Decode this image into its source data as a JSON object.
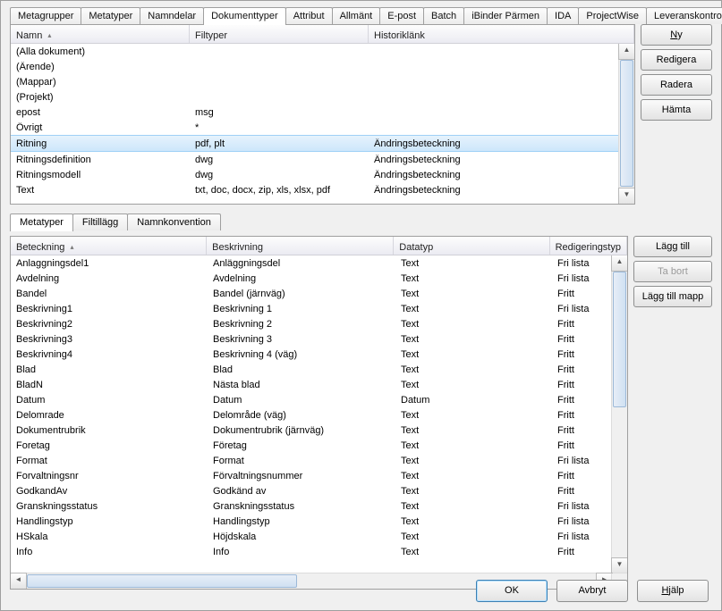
{
  "main_tabs": {
    "items": [
      "Metagrupper",
      "Metatyper",
      "Namndelar",
      "Dokumenttyper",
      "Attribut",
      "Allmänt",
      "E-post",
      "Batch",
      "iBinder Pärmen",
      "IDA",
      "ProjectWise",
      "Leveranskontroll"
    ],
    "active_index": 3
  },
  "top_grid": {
    "columns": [
      "Namn",
      "Filtyper",
      "Historiklänk"
    ],
    "sort_col": 0,
    "rows": [
      {
        "n": "(Alla dokument)",
        "f": "",
        "h": ""
      },
      {
        "n": "(Ärende)",
        "f": "",
        "h": ""
      },
      {
        "n": "(Mappar)",
        "f": "",
        "h": ""
      },
      {
        "n": "(Projekt)",
        "f": "",
        "h": ""
      },
      {
        "n": "epost",
        "f": "msg",
        "h": ""
      },
      {
        "n": "Övrigt",
        "f": "*",
        "h": ""
      },
      {
        "n": "Ritning",
        "f": "pdf, plt",
        "h": "Ändringsbeteckning",
        "sel": true
      },
      {
        "n": "Ritningsdefinition",
        "f": "dwg",
        "h": "Ändringsbeteckning"
      },
      {
        "n": "Ritningsmodell",
        "f": "dwg",
        "h": "Ändringsbeteckning"
      },
      {
        "n": "Text",
        "f": "txt, doc, docx, zip, xls, xlsx, pdf",
        "h": "Ändringsbeteckning"
      }
    ]
  },
  "top_buttons": {
    "ny": "Ny",
    "redigera": "Redigera",
    "radera": "Radera",
    "hamta": "Hämta"
  },
  "sub_tabs": {
    "items": [
      "Metatyper",
      "Filtillägg",
      "Namnkonvention"
    ],
    "active_index": 0
  },
  "bottom_grid": {
    "columns": [
      "Beteckning",
      "Beskrivning",
      "Datatyp",
      "Redigeringstyp"
    ],
    "sort_col": 0,
    "rows": [
      {
        "b": "Anlaggningsdel1",
        "d": "Anläggningsdel",
        "t": "Text",
        "r": "Fri lista"
      },
      {
        "b": "Avdelning",
        "d": "Avdelning",
        "t": "Text",
        "r": "Fri lista"
      },
      {
        "b": "Bandel",
        "d": "Bandel (järnväg)",
        "t": "Text",
        "r": "Fritt"
      },
      {
        "b": "Beskrivning1",
        "d": "Beskrivning 1",
        "t": "Text",
        "r": "Fri lista"
      },
      {
        "b": "Beskrivning2",
        "d": "Beskrivning 2",
        "t": "Text",
        "r": "Fritt"
      },
      {
        "b": "Beskrivning3",
        "d": "Beskrivning 3",
        "t": "Text",
        "r": "Fritt"
      },
      {
        "b": "Beskrivning4",
        "d": "Beskrivning 4 (väg)",
        "t": "Text",
        "r": "Fritt"
      },
      {
        "b": "Blad",
        "d": "Blad",
        "t": "Text",
        "r": "Fritt"
      },
      {
        "b": "BladN",
        "d": "Nästa blad",
        "t": "Text",
        "r": "Fritt"
      },
      {
        "b": "Datum",
        "d": "Datum",
        "t": "Datum",
        "r": "Fritt"
      },
      {
        "b": "Delomrade",
        "d": "Delområde (väg)",
        "t": "Text",
        "r": "Fritt"
      },
      {
        "b": "Dokumentrubrik",
        "d": "Dokumentrubrik (järnväg)",
        "t": "Text",
        "r": "Fritt"
      },
      {
        "b": "Foretag",
        "d": "Företag",
        "t": "Text",
        "r": "Fritt"
      },
      {
        "b": "Format",
        "d": "Format",
        "t": "Text",
        "r": "Fri lista"
      },
      {
        "b": "Forvaltningsnr",
        "d": "Förvaltningsnummer",
        "t": "Text",
        "r": "Fritt"
      },
      {
        "b": "GodkandAv",
        "d": "Godkänd av",
        "t": "Text",
        "r": "Fritt"
      },
      {
        "b": "Granskningsstatus",
        "d": "Granskningsstatus",
        "t": "Text",
        "r": "Fri lista"
      },
      {
        "b": "Handlingstyp",
        "d": "Handlingstyp",
        "t": "Text",
        "r": "Fri lista"
      },
      {
        "b": "HSkala",
        "d": "Höjdskala",
        "t": "Text",
        "r": "Fri lista"
      },
      {
        "b": "Info",
        "d": "Info",
        "t": "Text",
        "r": "Fritt"
      }
    ]
  },
  "bottom_buttons": {
    "lagg": "Lägg till",
    "tabort": "Ta bort",
    "mapp": "Lägg till mapp"
  },
  "dialog_buttons": {
    "ok": "OK",
    "avbryt": "Avbryt",
    "hjalp": "Hjälp"
  }
}
